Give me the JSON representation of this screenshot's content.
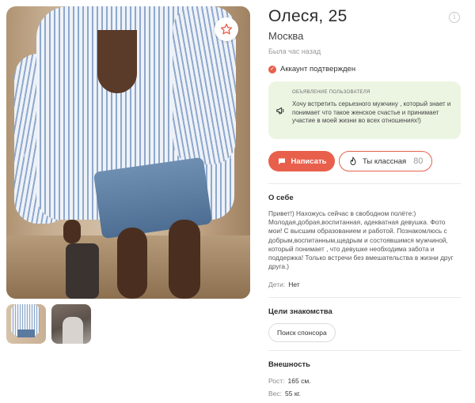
{
  "profile": {
    "name_age": "Олеся, 25",
    "city": "Москва",
    "last_seen": "Была час назад",
    "verified_label": "Аккаунт подтвержден"
  },
  "announcement": {
    "title": "ОБЪЯВЛЕНИЕ ПОЛЬЗОВАТЕЛЯ",
    "text": "Хочу встретить серьезного мужчину , который знает и понимает что такое женское счастье и принимает участие в моей жизни во всех отношениях!)"
  },
  "actions": {
    "write_label": "Написать",
    "like_label": "Ты классная",
    "like_count": "80"
  },
  "about": {
    "title": "О себе",
    "text": "Привет!) Нахожусь сейчас в свободном полёте:) Молодая,добрая,воспитанная, адекватная девушка. Фото мои! С высшим образованием и работой. Познакомлюсь с добрым,воспитанным,щедрым и состоявшимся мужчиной, который понимает , что девушке необходима забота и поддержка! Только встречи без вмешательства в жизни друг друга.)",
    "kids_label": "Дети:",
    "kids_value": "Нет"
  },
  "goals": {
    "title": "Цели знакомства",
    "items": [
      "Поиск спонсора"
    ]
  },
  "appearance": {
    "title": "Внешность",
    "height_label": "Рост:",
    "height_value": "165 см.",
    "weight_label": "Вес:",
    "weight_value": "55 кг."
  },
  "icons": {
    "favorite": "star-outline-icon",
    "info": "info-icon",
    "verified": "check-circle-icon",
    "announcement": "megaphone-icon",
    "write": "chat-bubble-icon",
    "like": "flame-icon",
    "prev": "chevron-left-icon",
    "next": "chevron-right-icon"
  },
  "colors": {
    "accent": "#e8604c",
    "announcement_bg": "#ecf5e2",
    "muted_text": "#9a9a9a"
  }
}
